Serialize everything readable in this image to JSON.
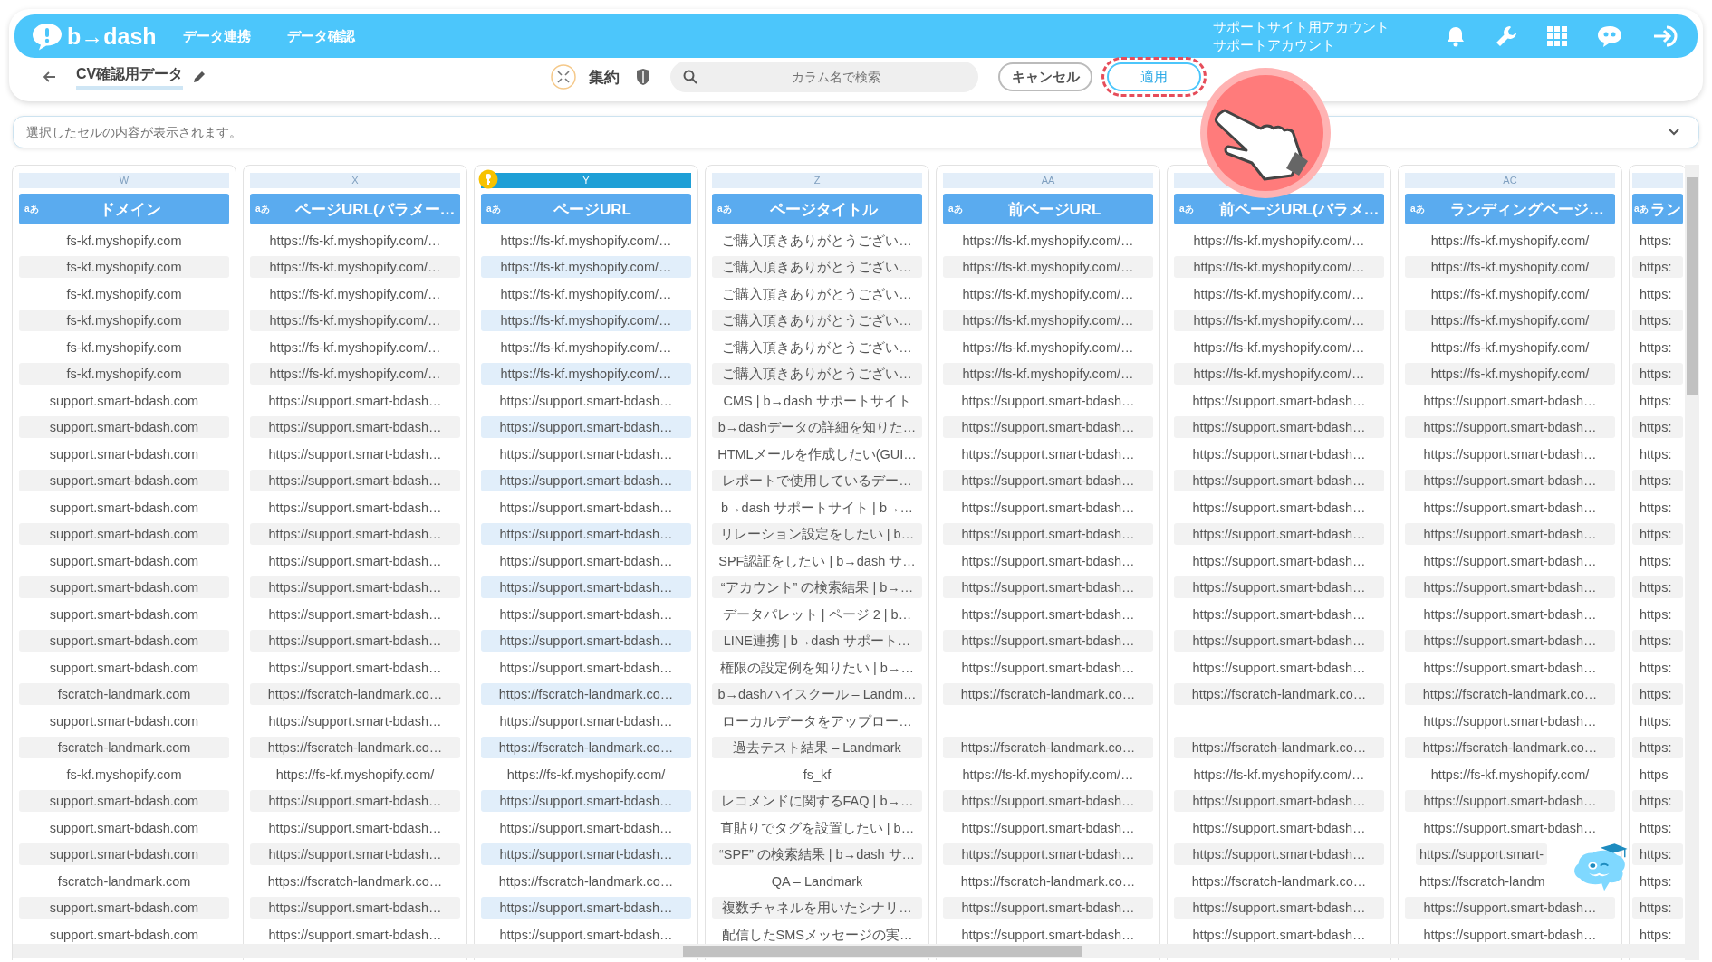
{
  "header": {
    "logo": "b→dash",
    "nav": [
      {
        "label": "データ連携"
      },
      {
        "label": "データ確認"
      }
    ],
    "account_lines": [
      "サポートサイト用アカウント",
      "サポートアカウント"
    ]
  },
  "toolbar": {
    "dataset_name": "CV確認用データ",
    "aggregate_label": "集約",
    "search": {
      "placeholder": "カラム名で検索"
    },
    "buttons": [
      {
        "label": "キャンセル",
        "kind": "cancel",
        "highlighted": false
      },
      {
        "label": "適用",
        "kind": "apply",
        "highlighted": true
      }
    ]
  },
  "cell_preview": {
    "placeholder": "選択したセルの内容が表示されます。"
  },
  "columns": [
    {
      "letter": "W",
      "type": "aあ",
      "name": "ドメイン",
      "selected": false,
      "key": false,
      "cells": [
        "fs-kf.myshopify.com",
        "fs-kf.myshopify.com",
        "fs-kf.myshopify.com",
        "fs-kf.myshopify.com",
        "fs-kf.myshopify.com",
        "fs-kf.myshopify.com",
        "support.smart-bdash.com",
        "support.smart-bdash.com",
        "support.smart-bdash.com",
        "support.smart-bdash.com",
        "support.smart-bdash.com",
        "support.smart-bdash.com",
        "support.smart-bdash.com",
        "support.smart-bdash.com",
        "support.smart-bdash.com",
        "support.smart-bdash.com",
        "support.smart-bdash.com",
        "fscratch-landmark.com",
        "support.smart-bdash.com",
        "fscratch-landmark.com",
        "fs-kf.myshopify.com",
        "support.smart-bdash.com",
        "support.smart-bdash.com",
        "support.smart-bdash.com",
        "fscratch-landmark.com",
        "support.smart-bdash.com",
        "support.smart-bdash.com"
      ]
    },
    {
      "letter": "X",
      "type": "aあ",
      "name": "ページURL(パラメー…",
      "selected": false,
      "key": false,
      "cells": [
        "https://fs-kf.myshopify.com/…",
        "https://fs-kf.myshopify.com/…",
        "https://fs-kf.myshopify.com/…",
        "https://fs-kf.myshopify.com/…",
        "https://fs-kf.myshopify.com/…",
        "https://fs-kf.myshopify.com/…",
        "https://support.smart-bdash…",
        "https://support.smart-bdash…",
        "https://support.smart-bdash…",
        "https://support.smart-bdash…",
        "https://support.smart-bdash…",
        "https://support.smart-bdash…",
        "https://support.smart-bdash…",
        "https://support.smart-bdash…",
        "https://support.smart-bdash…",
        "https://support.smart-bdash…",
        "https://support.smart-bdash…",
        "https://fscratch-landmark.co…",
        "https://support.smart-bdash…",
        "https://fscratch-landmark.co…",
        "https://fs-kf.myshopify.com/",
        "https://support.smart-bdash…",
        "https://support.smart-bdash…",
        "https://support.smart-bdash…",
        "https://fscratch-landmark.co…",
        "https://support.smart-bdash…",
        "https://support.smart-bdash…"
      ]
    },
    {
      "letter": "Y",
      "type": "aあ",
      "name": "ページURL",
      "selected": true,
      "key": true,
      "cells": [
        "https://fs-kf.myshopify.com/…",
        "https://fs-kf.myshopify.com/…",
        "https://fs-kf.myshopify.com/…",
        "https://fs-kf.myshopify.com/…",
        "https://fs-kf.myshopify.com/…",
        "https://fs-kf.myshopify.com/…",
        "https://support.smart-bdash…",
        "https://support.smart-bdash…",
        "https://support.smart-bdash…",
        "https://support.smart-bdash…",
        "https://support.smart-bdash…",
        "https://support.smart-bdash…",
        "https://support.smart-bdash…",
        "https://support.smart-bdash…",
        "https://support.smart-bdash…",
        "https://support.smart-bdash…",
        "https://support.smart-bdash…",
        "https://fscratch-landmark.co…",
        "https://support.smart-bdash…",
        "https://fscratch-landmark.co…",
        "https://fs-kf.myshopify.com/",
        "https://support.smart-bdash…",
        "https://support.smart-bdash…",
        "https://support.smart-bdash…",
        "https://fscratch-landmark.co…",
        "https://support.smart-bdash…",
        "https://support.smart-bdash…"
      ]
    },
    {
      "letter": "Z",
      "type": "aあ",
      "name": "ページタイトル",
      "selected": false,
      "key": false,
      "cells": [
        "ご購入頂きありがとうござい…",
        "ご購入頂きありがとうござい…",
        "ご購入頂きありがとうござい…",
        "ご購入頂きありがとうござい…",
        "ご購入頂きありがとうござい…",
        "ご購入頂きありがとうござい…",
        "CMS | b→dash サポートサイト",
        "b→dashデータの詳細を知りた…",
        "HTMLメールを作成したい(GUI…",
        "レポートで使用しているデー…",
        "b→dash サポートサイト | b→…",
        "リレーション設定をしたい | b…",
        "SPF認証をしたい | b→dash サ…",
        "“アカウント” の検索結果 | b→…",
        "データパレット | ページ 2 | b…",
        "LINE連携 | b→dash サポート…",
        "権限の設定例を知りたい | b→…",
        "b→dashハイスクール – Landm…",
        "ローカルデータをアップロー…",
        "過去テスト結果 – Landmark",
        "fs_kf",
        "レコメンドに関するFAQ | b→…",
        "直貼りでタグを設置したい | b…",
        "“SPF” の検索結果 | b→dash サ…",
        "QA – Landmark",
        "複数チャネルを用いたシナリ…",
        "配信したSMSメッセージの実…"
      ]
    },
    {
      "letter": "AA",
      "type": "aあ",
      "name": "前ページURL",
      "selected": false,
      "key": false,
      "cells": [
        "https://fs-kf.myshopify.com/…",
        "https://fs-kf.myshopify.com/…",
        "https://fs-kf.myshopify.com/…",
        "https://fs-kf.myshopify.com/…",
        "https://fs-kf.myshopify.com/…",
        "https://fs-kf.myshopify.com/…",
        "https://support.smart-bdash…",
        "https://support.smart-bdash…",
        "https://support.smart-bdash…",
        "https://support.smart-bdash…",
        "https://support.smart-bdash…",
        "https://support.smart-bdash…",
        "https://support.smart-bdash…",
        "https://support.smart-bdash…",
        "https://support.smart-bdash…",
        "https://support.smart-bdash…",
        "https://support.smart-bdash…",
        "https://fscratch-landmark.co…",
        null,
        "https://fscratch-landmark.co…",
        "https://fs-kf.myshopify.com/…",
        "https://support.smart-bdash…",
        "https://support.smart-bdash…",
        "https://support.smart-bdash…",
        "https://fscratch-landmark.co…",
        "https://support.smart-bdash…",
        "https://support.smart-bdash…"
      ]
    },
    {
      "type": "aあ",
      "name": "前ページURL(パラメ…",
      "selected": false,
      "key": false,
      "cells": [
        "https://fs-kf.myshopify.com/…",
        "https://fs-kf.myshopify.com/…",
        "https://fs-kf.myshopify.com/…",
        "https://fs-kf.myshopify.com/…",
        "https://fs-kf.myshopify.com/…",
        "https://fs-kf.myshopify.com/…",
        "https://support.smart-bdash…",
        "https://support.smart-bdash…",
        "https://support.smart-bdash…",
        "https://support.smart-bdash…",
        "https://support.smart-bdash…",
        "https://support.smart-bdash…",
        "https://support.smart-bdash…",
        "https://support.smart-bdash…",
        "https://support.smart-bdash…",
        "https://support.smart-bdash…",
        "https://support.smart-bdash…",
        "https://fscratch-landmark.co…",
        null,
        "https://fscratch-landmark.co…",
        "https://fs-kf.myshopify.com/…",
        "https://support.smart-bdash…",
        "https://support.smart-bdash…",
        "https://support.smart-bdash…",
        "https://fscratch-landmark.co…",
        "https://support.smart-bdash…",
        "https://support.smart-bdash…"
      ]
    },
    {
      "letter": "AC",
      "type": "aあ",
      "name": "ランディングページ…",
      "selected": false,
      "key": false,
      "cells": [
        "https://fs-kf.myshopify.com/",
        "https://fs-kf.myshopify.com/",
        "https://fs-kf.myshopify.com/",
        "https://fs-kf.myshopify.com/",
        "https://fs-kf.myshopify.com/",
        "https://fs-kf.myshopify.com/",
        "https://support.smart-bdash…",
        "https://support.smart-bdash…",
        "https://support.smart-bdash…",
        "https://support.smart-bdash…",
        "https://support.smart-bdash…",
        "https://support.smart-bdash…",
        "https://support.smart-bdash…",
        "https://support.smart-bdash…",
        "https://support.smart-bdash…",
        "https://support.smart-bdash…",
        "https://support.smart-bdash…",
        "https://fscratch-landmark.co…",
        "https://support.smart-bdash…",
        "https://fscratch-landmark.co…",
        "https://fs-kf.myshopify.com/",
        "https://support.smart-bdash…",
        "https://support.smart-bdash…",
        {
          "text": "https://support.smart-",
          "cut": true
        },
        {
          "text": "https://fscratch-landm",
          "cut": true
        },
        "https://support.smart-bdash…",
        "https://support.smart-bdash…"
      ]
    },
    {
      "type": "aあ",
      "name": "ラン",
      "selected": false,
      "key": false,
      "cells": [
        "https:",
        "https:",
        "https:",
        "https:",
        "https:",
        "https:",
        "https:",
        "https:",
        "https:",
        "https:",
        "https:",
        "https:",
        "https:",
        "https:",
        "https:",
        "https:",
        "https:",
        "https:",
        "https:",
        "https:",
        "https",
        "https:",
        "https:",
        "https:",
        "https:",
        "https:",
        "https:"
      ]
    }
  ]
}
